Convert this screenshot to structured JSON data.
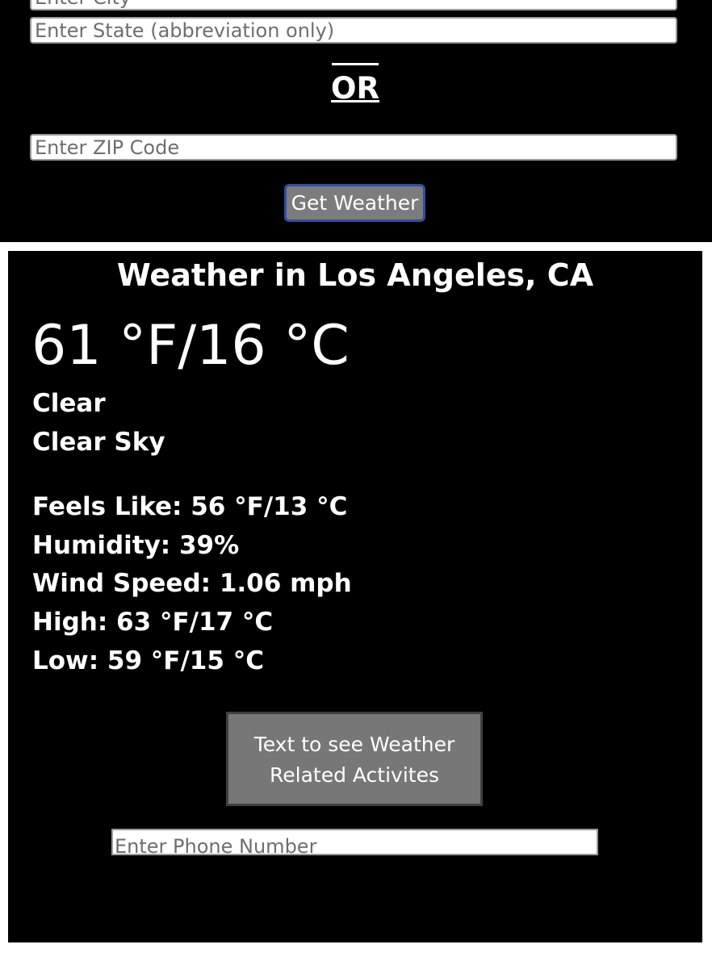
{
  "search": {
    "city_placeholder": "Enter City",
    "state_placeholder": "Enter State (abbreviation only)",
    "or_label": "OR",
    "zip_placeholder": "Enter ZIP Code",
    "submit_label": "Get Weather"
  },
  "result": {
    "title": "Weather in Los Angeles, CA",
    "temperature": "61 °F/16 °C",
    "condition": "Clear",
    "description": "Clear Sky",
    "feels_like": "Feels Like: 56 °F/13 °C",
    "humidity": "Humidity: 39%",
    "wind_speed": "Wind Speed: 1.06 mph",
    "high": "High: 63 °F/17 °C",
    "low": "Low: 59 °F/15 °C",
    "text_button_label": "Text to see Weather Related Activites",
    "phone_placeholder": "Enter Phone Number"
  },
  "colors": {
    "background": "#000000",
    "panel_border": "#ffffff",
    "button_gray": "#7c7c7c",
    "button_border_blue": "#2f4ea3"
  }
}
